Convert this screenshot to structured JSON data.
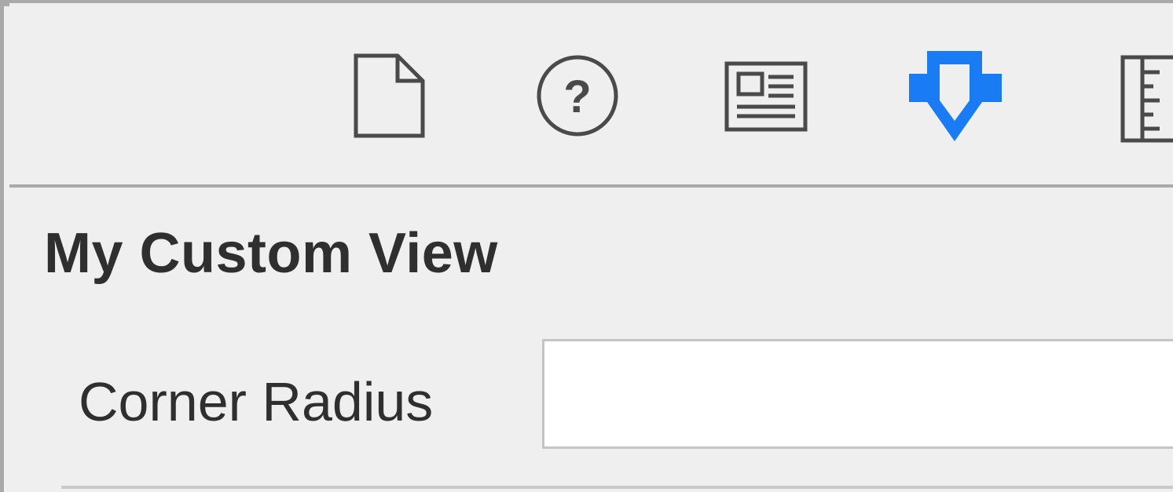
{
  "inspector": {
    "tabs": [
      {
        "name": "file-inspector",
        "icon": "file-icon",
        "active": false
      },
      {
        "name": "quick-help-inspector",
        "icon": "help-icon",
        "active": false
      },
      {
        "name": "identity-inspector",
        "icon": "identity-icon",
        "active": false
      },
      {
        "name": "attributes-inspector",
        "icon": "attributes-icon",
        "active": true
      },
      {
        "name": "size-inspector",
        "icon": "ruler-icon",
        "active": false
      }
    ],
    "colors": {
      "background": "#efefef",
      "icon": "#4a4a4a",
      "active_icon": "#1a7cf5",
      "text": "#2f2f2f"
    }
  },
  "section": {
    "title": "My Custom View"
  },
  "corner_radius": {
    "label": "Corner Radius",
    "value": "",
    "placeholder": ""
  }
}
